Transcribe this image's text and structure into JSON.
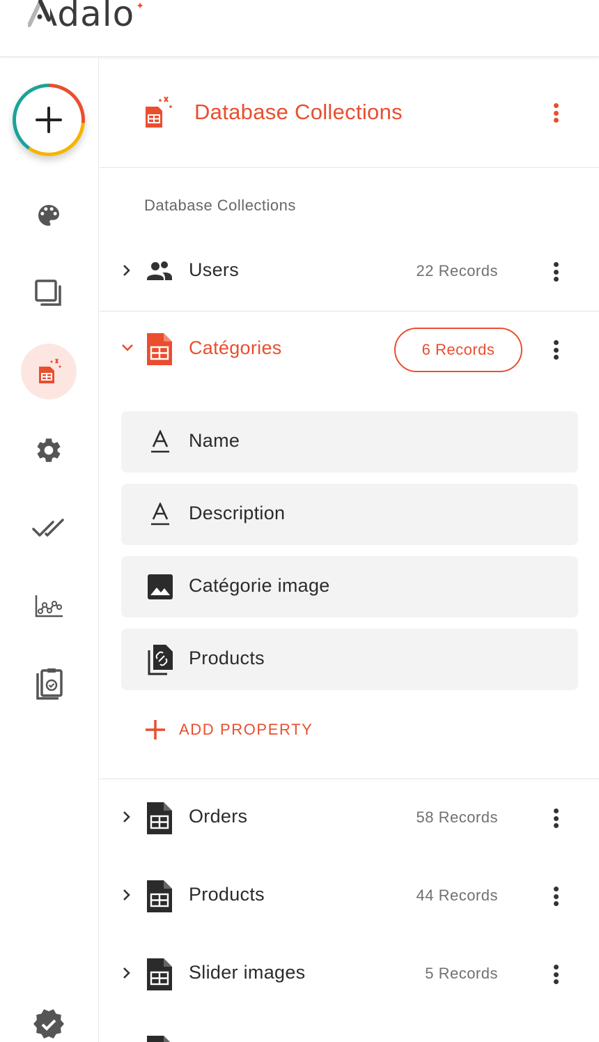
{
  "app": {
    "logo_text": "Adalo"
  },
  "header": {
    "title": "Database Collections"
  },
  "section": {
    "label": "Database Collections"
  },
  "collections": [
    {
      "name": "Users",
      "records": "22 Records"
    },
    {
      "name": "Catégories",
      "records": "6 Records"
    },
    {
      "name": "Orders",
      "records": "58 Records"
    },
    {
      "name": "Products",
      "records": "44 Records"
    },
    {
      "name": "Slider images",
      "records": "5 Records"
    }
  ],
  "properties": [
    {
      "name": "Name",
      "icon": "text-icon"
    },
    {
      "name": "Description",
      "icon": "text-icon"
    },
    {
      "name": "Catégorie image",
      "icon": "image-icon"
    },
    {
      "name": "Products",
      "icon": "relationship-icon"
    }
  ],
  "add_property": {
    "label": "ADD PROPERTY"
  },
  "colors": {
    "accent": "#e94e2f",
    "text": "#2b2b2b",
    "muted": "#707070",
    "property_bg": "#f3f3f3",
    "active_bg": "#fde6e1"
  },
  "sidebar": {
    "items": [
      {
        "icon": "add-icon"
      },
      {
        "icon": "palette-icon"
      },
      {
        "icon": "screens-icon"
      },
      {
        "icon": "database-icon",
        "active": true
      },
      {
        "icon": "gear-icon"
      },
      {
        "icon": "double-check-icon"
      },
      {
        "icon": "analytics-icon"
      },
      {
        "icon": "clipboard-check-icon"
      },
      {
        "icon": "verified-badge-icon"
      }
    ]
  }
}
